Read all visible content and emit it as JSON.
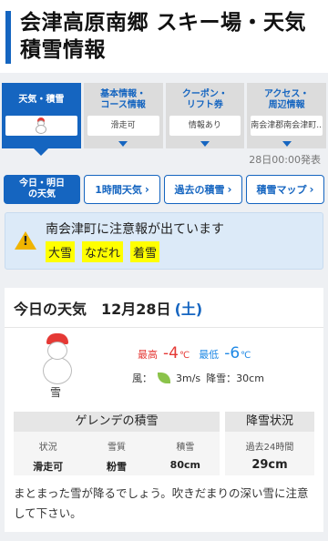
{
  "header": {
    "title_line1": "会津高原南郷 スキー場・天気",
    "title_line2": "積雪情報"
  },
  "tabs": [
    {
      "label": "天気・積雪",
      "value": ""
    },
    {
      "label": "基本情報・\nコース情報",
      "value": "滑走可"
    },
    {
      "label": "クーポン・\nリフト券",
      "value": "情報あり"
    },
    {
      "label": "アクセス・\n周辺情報",
      "value": "南会津郡南会津町..."
    }
  ],
  "updated": "28日00:00発表",
  "subnav": {
    "today": "今日・明日\nの天気",
    "hourly": "1時間天気",
    "past": "過去の積雪",
    "map": "積雪マップ"
  },
  "alert": {
    "text": "南会津町に注意報が出ています",
    "tags": [
      "大雪",
      "なだれ",
      "着雪"
    ]
  },
  "weather": {
    "title": "今日の天気",
    "date": "12月28日",
    "dow": "(土)",
    "condition": "雪",
    "high_label": "最高",
    "high": "-4",
    "low_label": "最低",
    "low": "-6",
    "temp_unit": "℃",
    "wind_label": "風：",
    "wind": "3m/s",
    "snow_label": "降雪：",
    "snow": "30cm",
    "colors": {
      "high": "#e53935",
      "low": "#1e88e5",
      "accent": "#1565c0"
    }
  },
  "slope": {
    "title": "ゲレンデの積雪",
    "headers": [
      "状況",
      "雪質",
      "積雪"
    ],
    "values": [
      "滑走可",
      "粉雪",
      "80cm"
    ]
  },
  "snowfall": {
    "title": "降雪状況",
    "header": "過去24時間",
    "value": "29cm"
  },
  "comment": "まとまった雪が降るでしょう。吹きだまりの深い雪に注意して下さい。"
}
